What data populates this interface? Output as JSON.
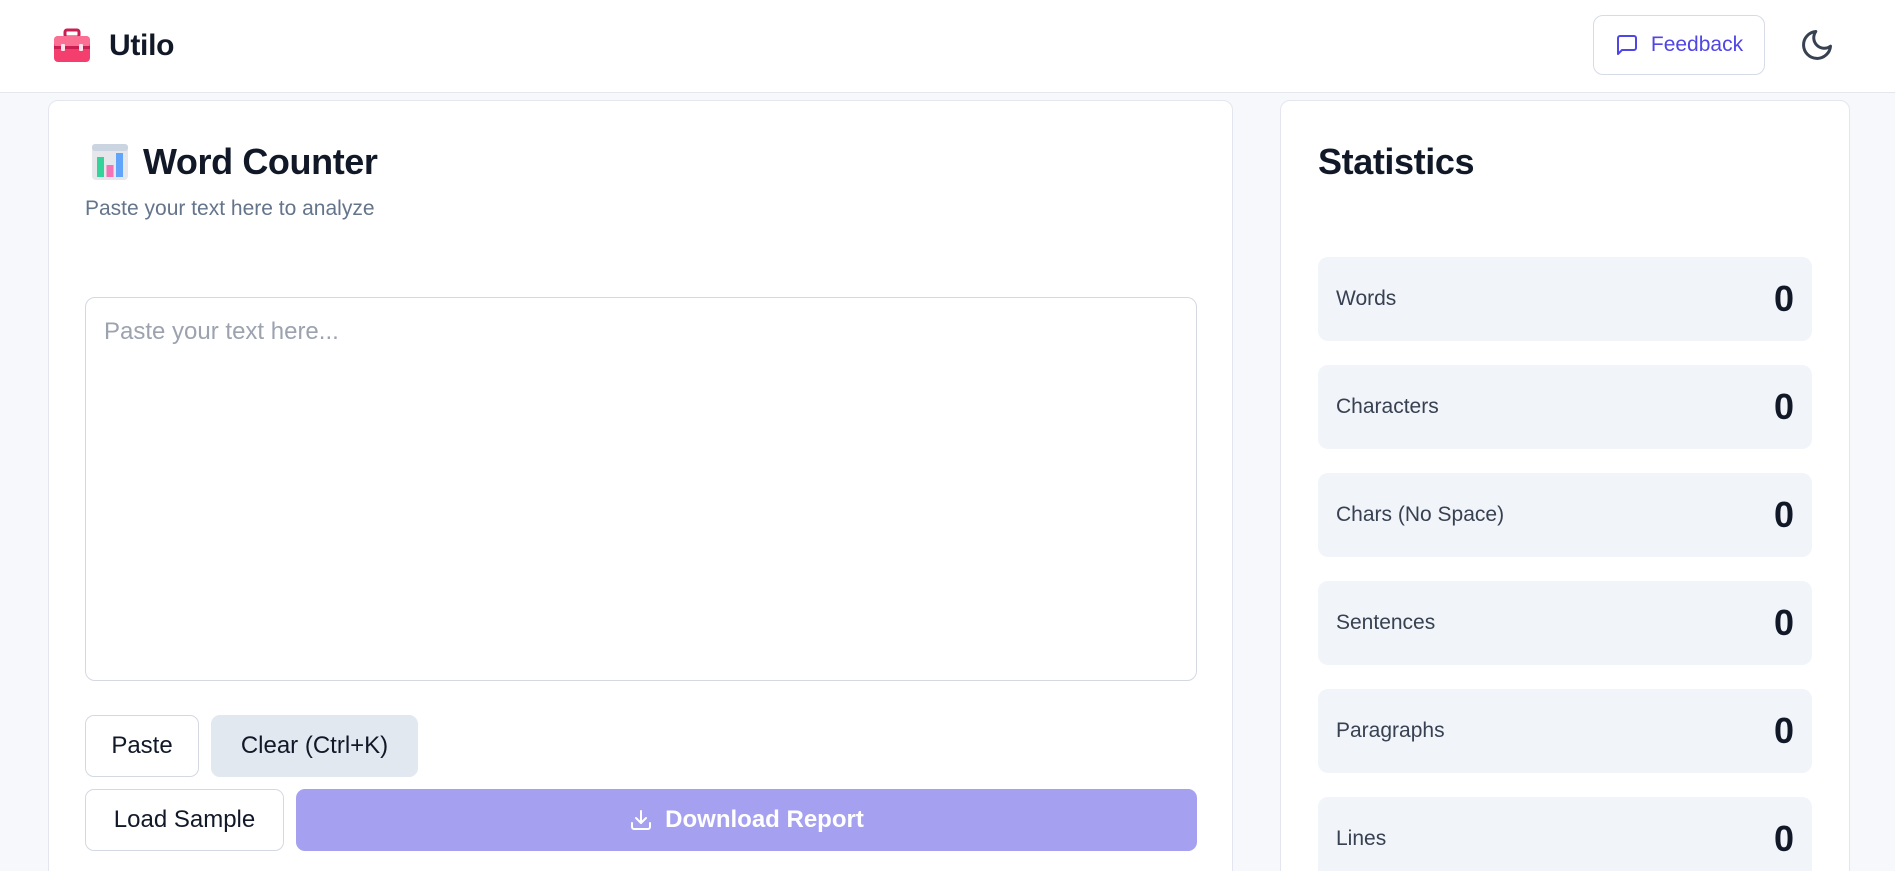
{
  "app": {
    "name": "Utilo"
  },
  "header": {
    "feedback_label": "Feedback"
  },
  "main": {
    "title": "Word Counter",
    "subtitle": "Paste your text here to analyze",
    "textarea_placeholder": "Paste your text here...",
    "textarea_value": "",
    "buttons": {
      "paste": "Paste",
      "clear": "Clear (Ctrl+K)",
      "load_sample": "Load Sample",
      "download": "Download Report"
    }
  },
  "stats": {
    "title": "Statistics",
    "items": [
      {
        "label": "Words",
        "value": "0"
      },
      {
        "label": "Characters",
        "value": "0"
      },
      {
        "label": "Chars (No Space)",
        "value": "0"
      },
      {
        "label": "Sentences",
        "value": "0"
      },
      {
        "label": "Paragraphs",
        "value": "0"
      },
      {
        "label": "Lines",
        "value": "0"
      }
    ]
  },
  "colors": {
    "accent": "#4f46e5",
    "download_button": "#a5a0f0",
    "brand_icon": "#f43f6e"
  },
  "icons": {
    "brand": "toolbox-icon",
    "feedback": "message-square-icon",
    "theme": "moon-icon",
    "title": "bar-chart-icon",
    "download": "download-icon"
  }
}
